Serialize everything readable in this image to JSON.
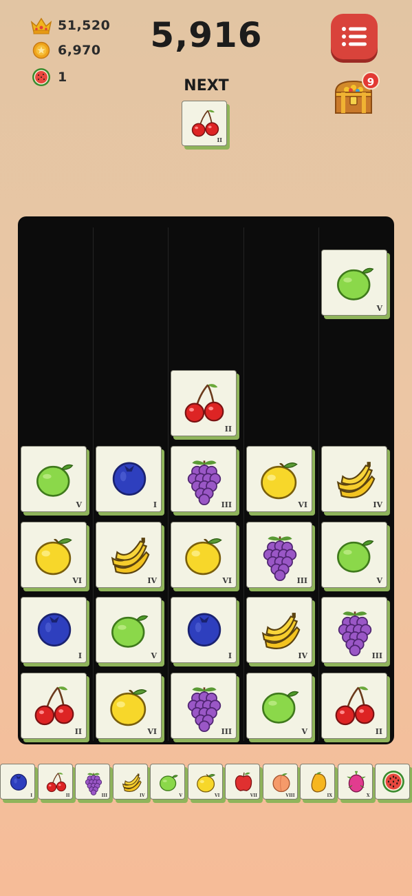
{
  "header": {
    "best_score": "51,520",
    "coins": "6,970",
    "watermelons": "1",
    "score": "5,916",
    "next_label": "NEXT",
    "chest_badge": "9"
  },
  "next_fruit": {
    "fruit": "cherry",
    "rank": "II"
  },
  "board": {
    "columns": 5,
    "rows": 7,
    "cells": [
      {
        "col": 5,
        "row": 1,
        "fruit": "lime",
        "rank": "V"
      },
      {
        "col": 3,
        "row": 3,
        "fruit": "cherry",
        "rank": "II"
      },
      {
        "col": 1,
        "row": 4,
        "fruit": "lime",
        "rank": "V"
      },
      {
        "col": 2,
        "row": 4,
        "fruit": "blueberry",
        "rank": "I"
      },
      {
        "col": 3,
        "row": 4,
        "fruit": "grape",
        "rank": "III"
      },
      {
        "col": 4,
        "row": 4,
        "fruit": "lemon",
        "rank": "VI"
      },
      {
        "col": 5,
        "row": 4,
        "fruit": "banana",
        "rank": "IV"
      },
      {
        "col": 1,
        "row": 5,
        "fruit": "lemon",
        "rank": "VI"
      },
      {
        "col": 2,
        "row": 5,
        "fruit": "banana",
        "rank": "IV"
      },
      {
        "col": 3,
        "row": 5,
        "fruit": "lemon",
        "rank": "VI"
      },
      {
        "col": 4,
        "row": 5,
        "fruit": "grape",
        "rank": "III"
      },
      {
        "col": 5,
        "row": 5,
        "fruit": "lime",
        "rank": "V"
      },
      {
        "col": 1,
        "row": 6,
        "fruit": "blueberry",
        "rank": "I"
      },
      {
        "col": 2,
        "row": 6,
        "fruit": "lime",
        "rank": "V"
      },
      {
        "col": 3,
        "row": 6,
        "fruit": "blueberry",
        "rank": "I"
      },
      {
        "col": 4,
        "row": 6,
        "fruit": "banana",
        "rank": "IV"
      },
      {
        "col": 5,
        "row": 6,
        "fruit": "grape",
        "rank": "III"
      },
      {
        "col": 1,
        "row": 7,
        "fruit": "cherry",
        "rank": "II"
      },
      {
        "col": 2,
        "row": 7,
        "fruit": "lemon",
        "rank": "VI"
      },
      {
        "col": 3,
        "row": 7,
        "fruit": "grape",
        "rank": "III"
      },
      {
        "col": 4,
        "row": 7,
        "fruit": "lime",
        "rank": "V"
      },
      {
        "col": 5,
        "row": 7,
        "fruit": "cherry",
        "rank": "II"
      }
    ]
  },
  "legend": [
    {
      "fruit": "blueberry",
      "rank": "I"
    },
    {
      "fruit": "cherry",
      "rank": "II"
    },
    {
      "fruit": "grape",
      "rank": "III"
    },
    {
      "fruit": "banana",
      "rank": "IV"
    },
    {
      "fruit": "lime",
      "rank": "V"
    },
    {
      "fruit": "lemon",
      "rank": "VI"
    },
    {
      "fruit": "apple",
      "rank": "VII"
    },
    {
      "fruit": "peach",
      "rank": "VIII"
    },
    {
      "fruit": "mango",
      "rank": "IX"
    },
    {
      "fruit": "dragonfruit",
      "rank": "X"
    },
    {
      "fruit": "watermelon",
      "rank": ""
    }
  ],
  "icons": {
    "best": "crown-icon",
    "coins": "coin-icon",
    "watermelons": "watermelon-icon",
    "menu": "menu-icon",
    "chest": "treasure-chest-icon"
  },
  "colors": {
    "menu_button": "#d9433b",
    "board_bg": "#0c0c0c",
    "tile_face": "#f3f3e4",
    "tile_shadow": "#8fb45b",
    "badge": "#e23a34"
  }
}
